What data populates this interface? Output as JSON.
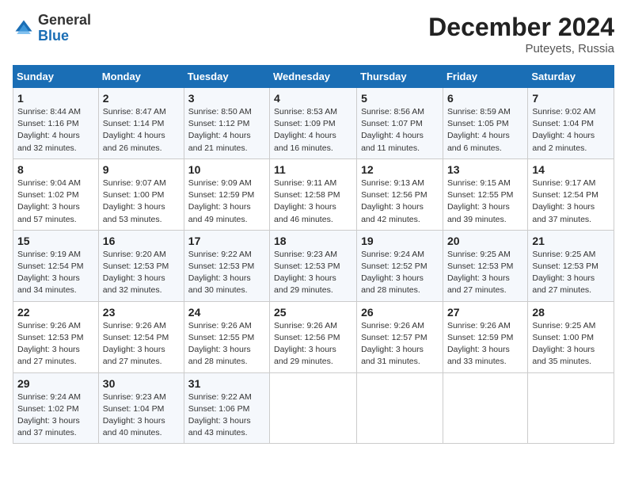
{
  "logo": {
    "general": "General",
    "blue": "Blue"
  },
  "title": {
    "month_year": "December 2024",
    "location": "Puteyets, Russia"
  },
  "weekdays": [
    "Sunday",
    "Monday",
    "Tuesday",
    "Wednesday",
    "Thursday",
    "Friday",
    "Saturday"
  ],
  "weeks": [
    [
      {
        "day": "1",
        "sunrise": "Sunrise: 8:44 AM",
        "sunset": "Sunset: 1:16 PM",
        "daylight": "Daylight: 4 hours and 32 minutes."
      },
      {
        "day": "2",
        "sunrise": "Sunrise: 8:47 AM",
        "sunset": "Sunset: 1:14 PM",
        "daylight": "Daylight: 4 hours and 26 minutes."
      },
      {
        "day": "3",
        "sunrise": "Sunrise: 8:50 AM",
        "sunset": "Sunset: 1:12 PM",
        "daylight": "Daylight: 4 hours and 21 minutes."
      },
      {
        "day": "4",
        "sunrise": "Sunrise: 8:53 AM",
        "sunset": "Sunset: 1:09 PM",
        "daylight": "Daylight: 4 hours and 16 minutes."
      },
      {
        "day": "5",
        "sunrise": "Sunrise: 8:56 AM",
        "sunset": "Sunset: 1:07 PM",
        "daylight": "Daylight: 4 hours and 11 minutes."
      },
      {
        "day": "6",
        "sunrise": "Sunrise: 8:59 AM",
        "sunset": "Sunset: 1:05 PM",
        "daylight": "Daylight: 4 hours and 6 minutes."
      },
      {
        "day": "7",
        "sunrise": "Sunrise: 9:02 AM",
        "sunset": "Sunset: 1:04 PM",
        "daylight": "Daylight: 4 hours and 2 minutes."
      }
    ],
    [
      {
        "day": "8",
        "sunrise": "Sunrise: 9:04 AM",
        "sunset": "Sunset: 1:02 PM",
        "daylight": "Daylight: 3 hours and 57 minutes."
      },
      {
        "day": "9",
        "sunrise": "Sunrise: 9:07 AM",
        "sunset": "Sunset: 1:00 PM",
        "daylight": "Daylight: 3 hours and 53 minutes."
      },
      {
        "day": "10",
        "sunrise": "Sunrise: 9:09 AM",
        "sunset": "Sunset: 12:59 PM",
        "daylight": "Daylight: 3 hours and 49 minutes."
      },
      {
        "day": "11",
        "sunrise": "Sunrise: 9:11 AM",
        "sunset": "Sunset: 12:58 PM",
        "daylight": "Daylight: 3 hours and 46 minutes."
      },
      {
        "day": "12",
        "sunrise": "Sunrise: 9:13 AM",
        "sunset": "Sunset: 12:56 PM",
        "daylight": "Daylight: 3 hours and 42 minutes."
      },
      {
        "day": "13",
        "sunrise": "Sunrise: 9:15 AM",
        "sunset": "Sunset: 12:55 PM",
        "daylight": "Daylight: 3 hours and 39 minutes."
      },
      {
        "day": "14",
        "sunrise": "Sunrise: 9:17 AM",
        "sunset": "Sunset: 12:54 PM",
        "daylight": "Daylight: 3 hours and 37 minutes."
      }
    ],
    [
      {
        "day": "15",
        "sunrise": "Sunrise: 9:19 AM",
        "sunset": "Sunset: 12:54 PM",
        "daylight": "Daylight: 3 hours and 34 minutes."
      },
      {
        "day": "16",
        "sunrise": "Sunrise: 9:20 AM",
        "sunset": "Sunset: 12:53 PM",
        "daylight": "Daylight: 3 hours and 32 minutes."
      },
      {
        "day": "17",
        "sunrise": "Sunrise: 9:22 AM",
        "sunset": "Sunset: 12:53 PM",
        "daylight": "Daylight: 3 hours and 30 minutes."
      },
      {
        "day": "18",
        "sunrise": "Sunrise: 9:23 AM",
        "sunset": "Sunset: 12:53 PM",
        "daylight": "Daylight: 3 hours and 29 minutes."
      },
      {
        "day": "19",
        "sunrise": "Sunrise: 9:24 AM",
        "sunset": "Sunset: 12:52 PM",
        "daylight": "Daylight: 3 hours and 28 minutes."
      },
      {
        "day": "20",
        "sunrise": "Sunrise: 9:25 AM",
        "sunset": "Sunset: 12:53 PM",
        "daylight": "Daylight: 3 hours and 27 minutes."
      },
      {
        "day": "21",
        "sunrise": "Sunrise: 9:25 AM",
        "sunset": "Sunset: 12:53 PM",
        "daylight": "Daylight: 3 hours and 27 minutes."
      }
    ],
    [
      {
        "day": "22",
        "sunrise": "Sunrise: 9:26 AM",
        "sunset": "Sunset: 12:53 PM",
        "daylight": "Daylight: 3 hours and 27 minutes."
      },
      {
        "day": "23",
        "sunrise": "Sunrise: 9:26 AM",
        "sunset": "Sunset: 12:54 PM",
        "daylight": "Daylight: 3 hours and 27 minutes."
      },
      {
        "day": "24",
        "sunrise": "Sunrise: 9:26 AM",
        "sunset": "Sunset: 12:55 PM",
        "daylight": "Daylight: 3 hours and 28 minutes."
      },
      {
        "day": "25",
        "sunrise": "Sunrise: 9:26 AM",
        "sunset": "Sunset: 12:56 PM",
        "daylight": "Daylight: 3 hours and 29 minutes."
      },
      {
        "day": "26",
        "sunrise": "Sunrise: 9:26 AM",
        "sunset": "Sunset: 12:57 PM",
        "daylight": "Daylight: 3 hours and 31 minutes."
      },
      {
        "day": "27",
        "sunrise": "Sunrise: 9:26 AM",
        "sunset": "Sunset: 12:59 PM",
        "daylight": "Daylight: 3 hours and 33 minutes."
      },
      {
        "day": "28",
        "sunrise": "Sunrise: 9:25 AM",
        "sunset": "Sunset: 1:00 PM",
        "daylight": "Daylight: 3 hours and 35 minutes."
      }
    ],
    [
      {
        "day": "29",
        "sunrise": "Sunrise: 9:24 AM",
        "sunset": "Sunset: 1:02 PM",
        "daylight": "Daylight: 3 hours and 37 minutes."
      },
      {
        "day": "30",
        "sunrise": "Sunrise: 9:23 AM",
        "sunset": "Sunset: 1:04 PM",
        "daylight": "Daylight: 3 hours and 40 minutes."
      },
      {
        "day": "31",
        "sunrise": "Sunrise: 9:22 AM",
        "sunset": "Sunset: 1:06 PM",
        "daylight": "Daylight: 3 hours and 43 minutes."
      },
      null,
      null,
      null,
      null
    ]
  ]
}
